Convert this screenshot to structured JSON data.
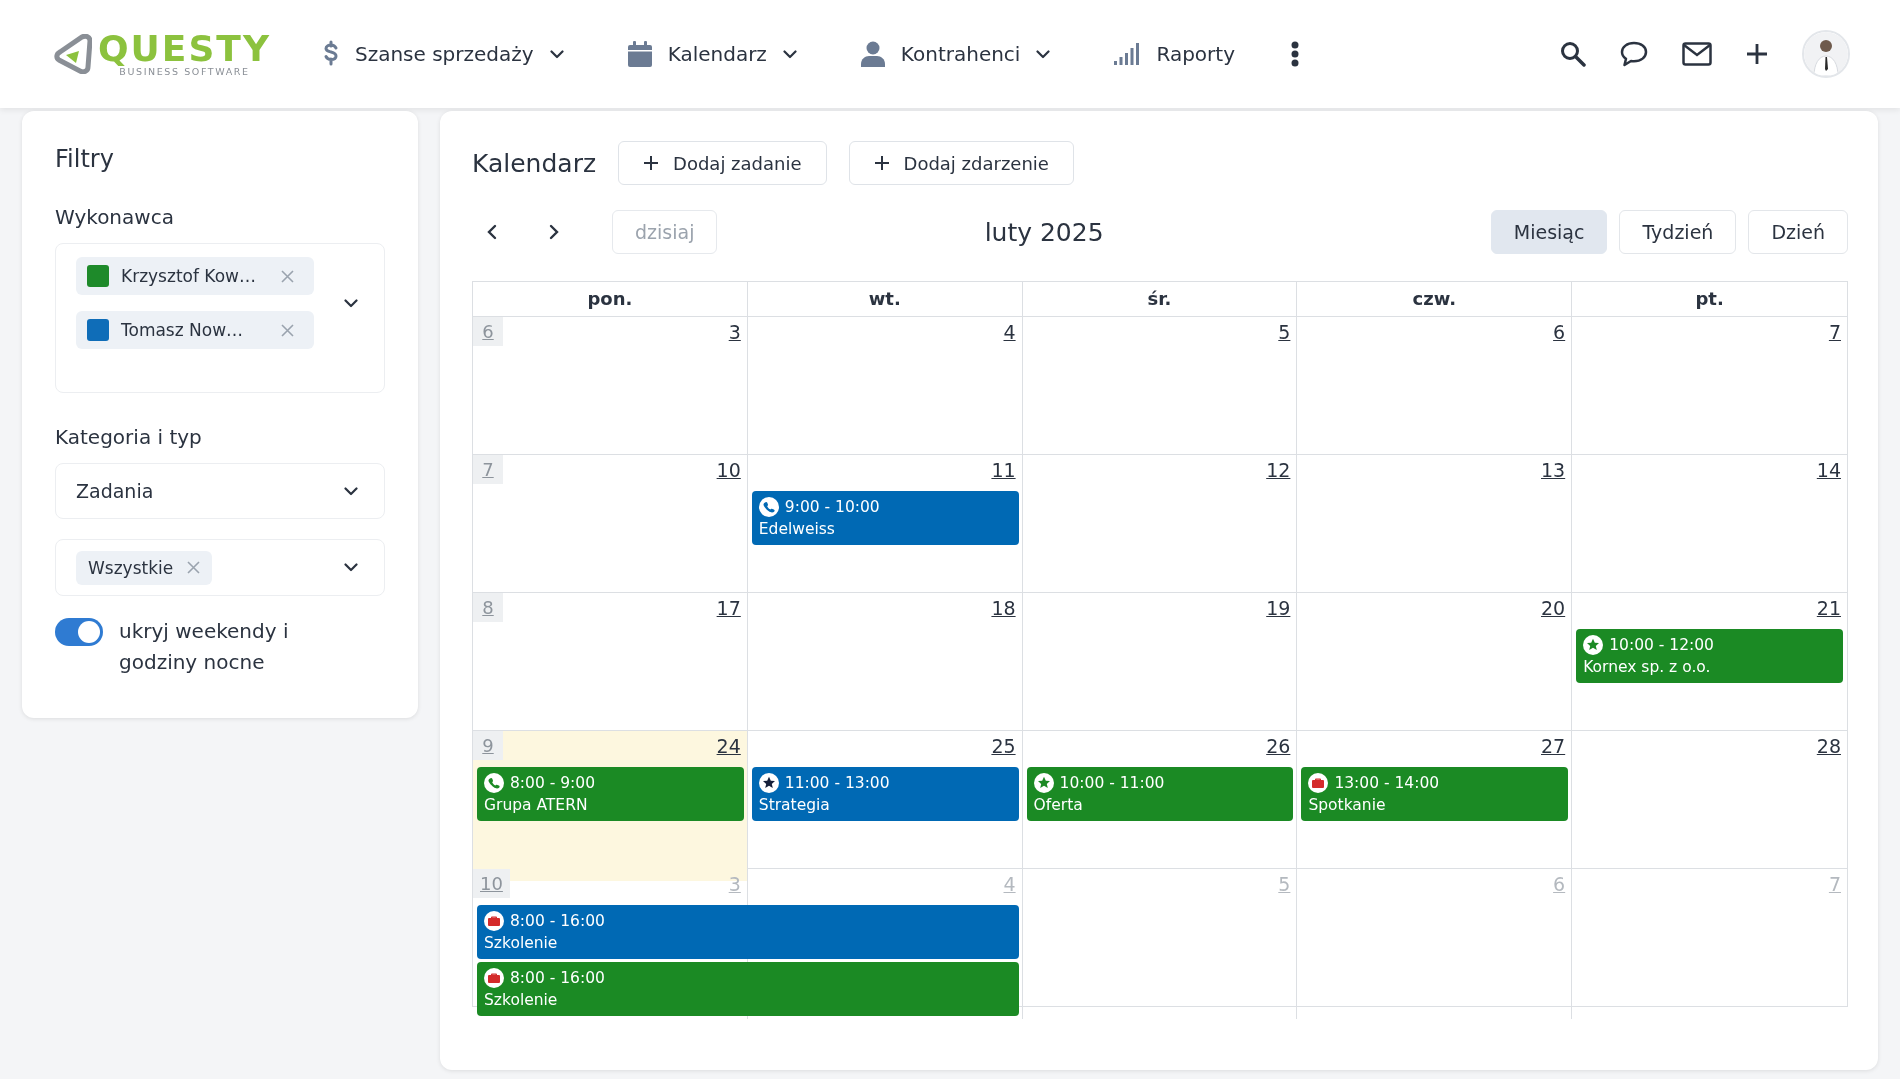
{
  "header": {
    "logo": {
      "name": "QUESTY",
      "tagline": "BUSINESS SOFTWARE"
    },
    "nav": [
      {
        "label": "Szanse sprzedaży",
        "kind": "dollar",
        "dropdown": true
      },
      {
        "label": "Kalendarz",
        "kind": "calendar",
        "dropdown": true
      },
      {
        "label": "Kontrahenci",
        "kind": "person",
        "dropdown": true
      },
      {
        "label": "Raporty",
        "kind": "bars",
        "dropdown": false
      }
    ]
  },
  "filters": {
    "title": "Filtry",
    "assignee": {
      "label": "Wykonawca",
      "chips": [
        {
          "text": "Krzysztof Kow…",
          "color": "#1e8a2a"
        },
        {
          "text": "Tomasz Now…",
          "color": "#0f6db8"
        }
      ]
    },
    "category": {
      "label": "Kategoria i typ",
      "value": "Zadania",
      "types": [
        {
          "text": "Wszystkie"
        }
      ]
    },
    "toggle": {
      "label": "ukryj weekendy i godziny nocne",
      "on": true
    }
  },
  "calendar": {
    "title": "Kalendarz",
    "actions": [
      "Dodaj zadanie",
      "Dodaj zdarzenie"
    ],
    "today_button": {
      "label": "dzisiaj",
      "disabled": true
    },
    "period": "luty 2025",
    "views": [
      {
        "label": "Miesiąc",
        "selected": true
      },
      {
        "label": "Tydzień",
        "selected": false
      },
      {
        "label": "Dzień",
        "selected": false
      }
    ],
    "weekdays": [
      "pon.",
      "wt.",
      "śr.",
      "czw.",
      "pt."
    ],
    "weeks": [
      {
        "week": "6",
        "days": [
          {
            "num": "3",
            "in_month": true,
            "today": false
          },
          {
            "num": "4",
            "in_month": true,
            "today": false
          },
          {
            "num": "5",
            "in_month": true,
            "today": false
          },
          {
            "num": "6",
            "in_month": true,
            "today": false
          },
          {
            "num": "7",
            "in_month": true,
            "today": false
          }
        ]
      },
      {
        "week": "7",
        "days": [
          {
            "num": "10",
            "in_month": true,
            "today": false
          },
          {
            "num": "11",
            "in_month": true,
            "today": false,
            "events": [
              {
                "time": "9:00 - 10:00",
                "title": "Edelweiss",
                "color": "#0069b4",
                "kind": "phone",
                "multi_day": false
              }
            ]
          },
          {
            "num": "12",
            "in_month": true,
            "today": false
          },
          {
            "num": "13",
            "in_month": true,
            "today": false
          },
          {
            "num": "14",
            "in_month": true,
            "today": false
          }
        ]
      },
      {
        "week": "8",
        "days": [
          {
            "num": "17",
            "in_month": true,
            "today": false
          },
          {
            "num": "18",
            "in_month": true,
            "today": false
          },
          {
            "num": "19",
            "in_month": true,
            "today": false
          },
          {
            "num": "20",
            "in_month": true,
            "today": false
          },
          {
            "num": "21",
            "in_month": true,
            "today": false,
            "events": [
              {
                "time": "10:00 - 12:00",
                "title": "Kornex sp. z o.o.",
                "color": "#1b8a24",
                "kind": "star"
              }
            ]
          }
        ]
      },
      {
        "week": "9",
        "days": [
          {
            "num": "24",
            "in_month": true,
            "today": true,
            "events": [
              {
                "time": "8:00 - 9:00",
                "title": "Grupa ATERN",
                "color": "#1b8a24",
                "kind": "phone",
                "multi_day": false
              }
            ]
          },
          {
            "num": "25",
            "in_month": true,
            "today": false,
            "events": [
              {
                "time": "11:00 - 13:00",
                "title": "Strategia",
                "color": "#0069b4",
                "kind": "star",
                "multi_day": false
              }
            ]
          },
          {
            "num": "26",
            "in_month": true,
            "today": false,
            "events": [
              {
                "time": "10:00 - 11:00",
                "title": "Oferta",
                "color": "#1b8a24",
                "kind": "star",
                "multi_day": false
              }
            ]
          },
          {
            "num": "27",
            "in_month": true,
            "today": false,
            "events": [
              {
                "time": "13:00 - 14:00",
                "title": "Spotkanie",
                "color": "#1b8a24",
                "kind": "briefcase",
                "multi_day": false
              }
            ]
          },
          {
            "num": "28",
            "in_month": true,
            "today": false
          }
        ]
      },
      {
        "week": "10",
        "days": [
          {
            "num": "3",
            "in_month": false,
            "today": false,
            "events": [
              {
                "time": "8:00 - 16:00",
                "title": "Szkolenie",
                "color": "#0069b4",
                "kind": "briefcase",
                "multi_day": true
              },
              {
                "time": "8:00 - 16:00",
                "title": "Szkolenie",
                "color": "#1b8a24",
                "kind": "briefcase",
                "multi_day": true
              }
            ]
          },
          {
            "num": "4",
            "in_month": false,
            "today": false
          },
          {
            "num": "5",
            "in_month": false,
            "today": false
          },
          {
            "num": "6",
            "in_month": false,
            "today": false
          },
          {
            "num": "7",
            "in_month": false,
            "today": false
          }
        ]
      }
    ]
  }
}
